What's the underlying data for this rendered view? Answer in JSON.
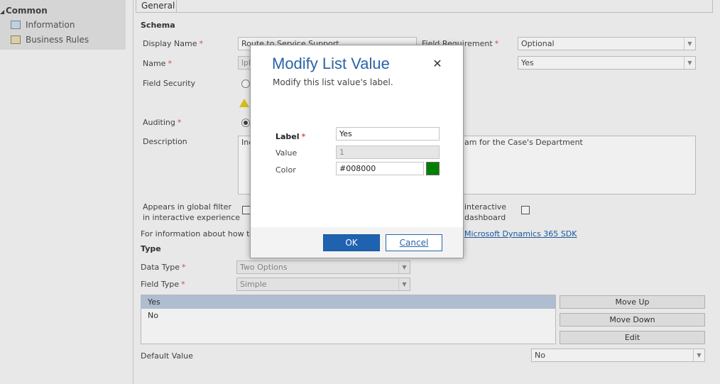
{
  "nav": {
    "section": "Common",
    "items": [
      {
        "label": "Information",
        "icon": "form-icon"
      },
      {
        "label": "Business Rules",
        "icon": "business-rules-icon"
      }
    ]
  },
  "tab": {
    "label": "General"
  },
  "schema": {
    "title": "Schema",
    "display_name_label": "Display Name",
    "display_name_value": "Route to Service Support",
    "field_requirement_label": "Field Requirement",
    "field_requirement_value": "Optional",
    "name_label": "Name",
    "name_value": "lpl",
    "name_right_value": "Yes",
    "field_security_label": "Field Security",
    "auditing_label": "Auditing",
    "description_label": "Description",
    "description_value": "Inc",
    "description_right_value": "am for the Case's Department",
    "global_filter_label_1": "Appears in global filter",
    "global_filter_label_2": "in interactive experience",
    "interactive_label_1": "interactive",
    "interactive_label_2": "dashboard",
    "info_text": "For information about how to",
    "sdk_link": "Microsoft Dynamics 365 SDK"
  },
  "type": {
    "title": "Type",
    "data_type_label": "Data Type",
    "data_type_value": "Two Options",
    "field_type_label": "Field Type",
    "field_type_value": "Simple",
    "options": [
      "Yes",
      "No"
    ],
    "move_up": "Move Up",
    "move_down": "Move Down",
    "edit": "Edit",
    "default_value_label": "Default Value",
    "default_value": "No"
  },
  "dialog": {
    "title": "Modify List Value",
    "subtitle": "Modify this list value's label.",
    "close_glyph": "✕",
    "label_label": "Label",
    "label_value": "Yes",
    "value_label": "Value",
    "value_value": "1",
    "color_label": "Color",
    "color_value": "#008000",
    "ok": "OK",
    "cancel": "Cancel"
  },
  "colors": {
    "accent": "#2b63a6",
    "primary_button": "#1f62b0",
    "required": "#e24e4e",
    "swatch": "#008000",
    "selected_row": "#b9c9de"
  },
  "req_mark": "*"
}
